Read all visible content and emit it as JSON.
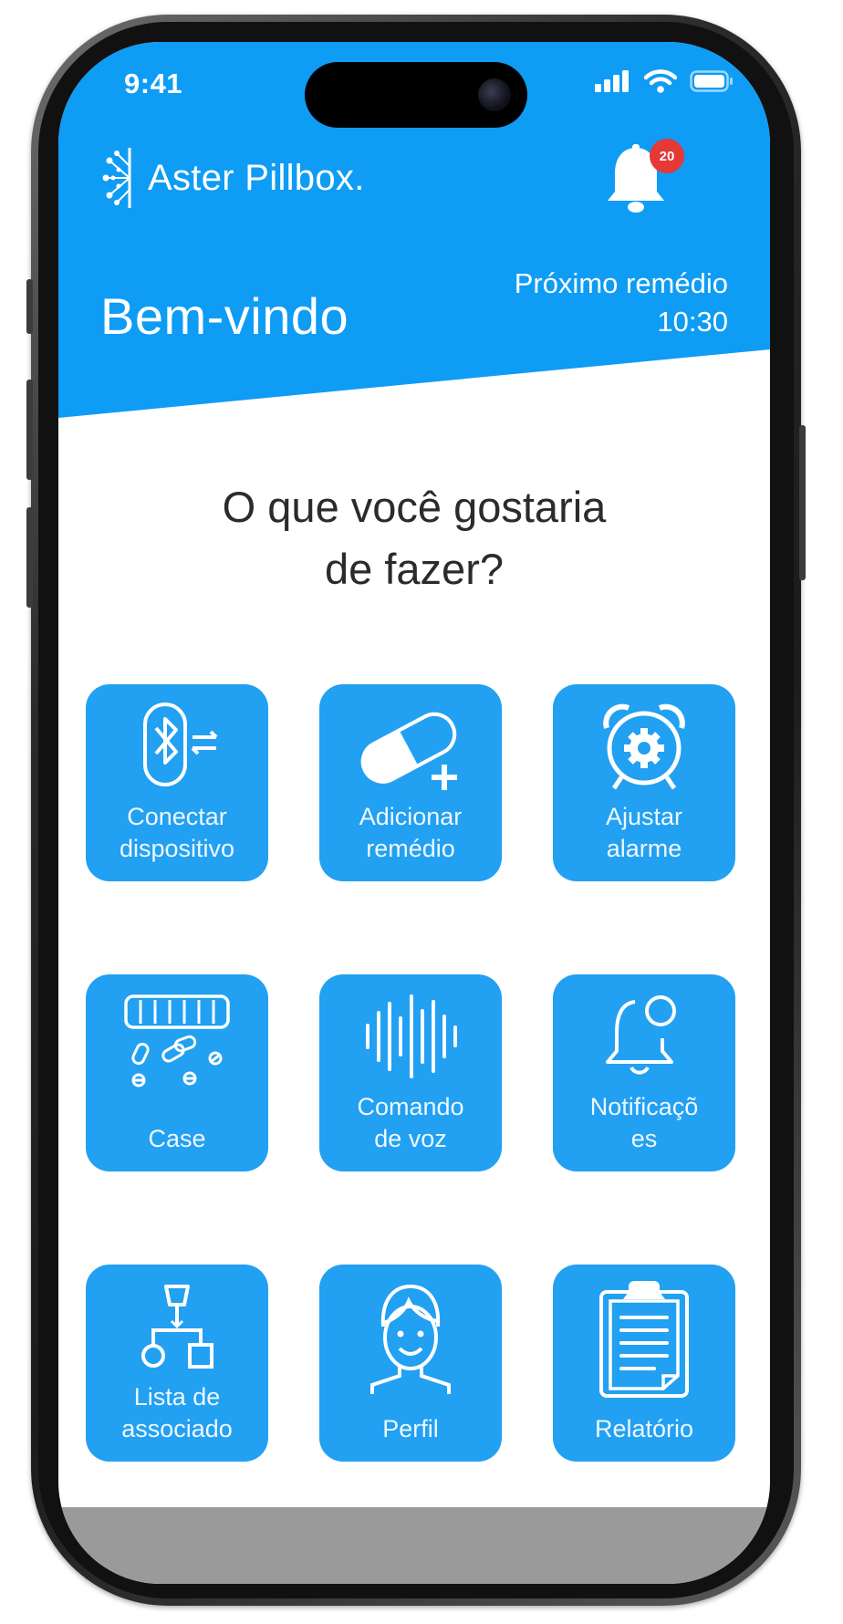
{
  "status_bar": {
    "time": "9:41"
  },
  "app": {
    "name": "Aster Pillbox."
  },
  "notifications": {
    "badge_count": "20"
  },
  "header": {
    "welcome": "Bem-vindo",
    "next_medicine_label": "Próximo remédio",
    "next_medicine_time": "10:30"
  },
  "question": {
    "line1": "O que você gostaria",
    "line2": "de fazer?"
  },
  "tiles": [
    {
      "line1": "Conectar",
      "line2": "dispositivo",
      "icon": "bluetooth-icon"
    },
    {
      "line1": "Adicionar",
      "line2": "remédio",
      "icon": "pill-add-icon"
    },
    {
      "line1": "Ajustar",
      "line2": "alarme",
      "icon": "alarm-clock-icon"
    },
    {
      "line1": "Case",
      "line2": "",
      "icon": "pillbox-case-icon"
    },
    {
      "line1": "Comando",
      "line2": "de voz",
      "icon": "voice-wave-icon"
    },
    {
      "line1": "Notificaçõ",
      "line2": "es",
      "icon": "notification-bell-icon"
    },
    {
      "line1": "Lista de",
      "line2": "associado",
      "icon": "hierarchy-icon"
    },
    {
      "line1": "Perfil",
      "line2": "",
      "icon": "profile-icon"
    },
    {
      "line1": "Relatório",
      "line2": "",
      "icon": "clipboard-report-icon"
    }
  ],
  "colors": {
    "primary": "#0e9cf5",
    "tile": "#22a0f2",
    "badge": "#e53935"
  }
}
